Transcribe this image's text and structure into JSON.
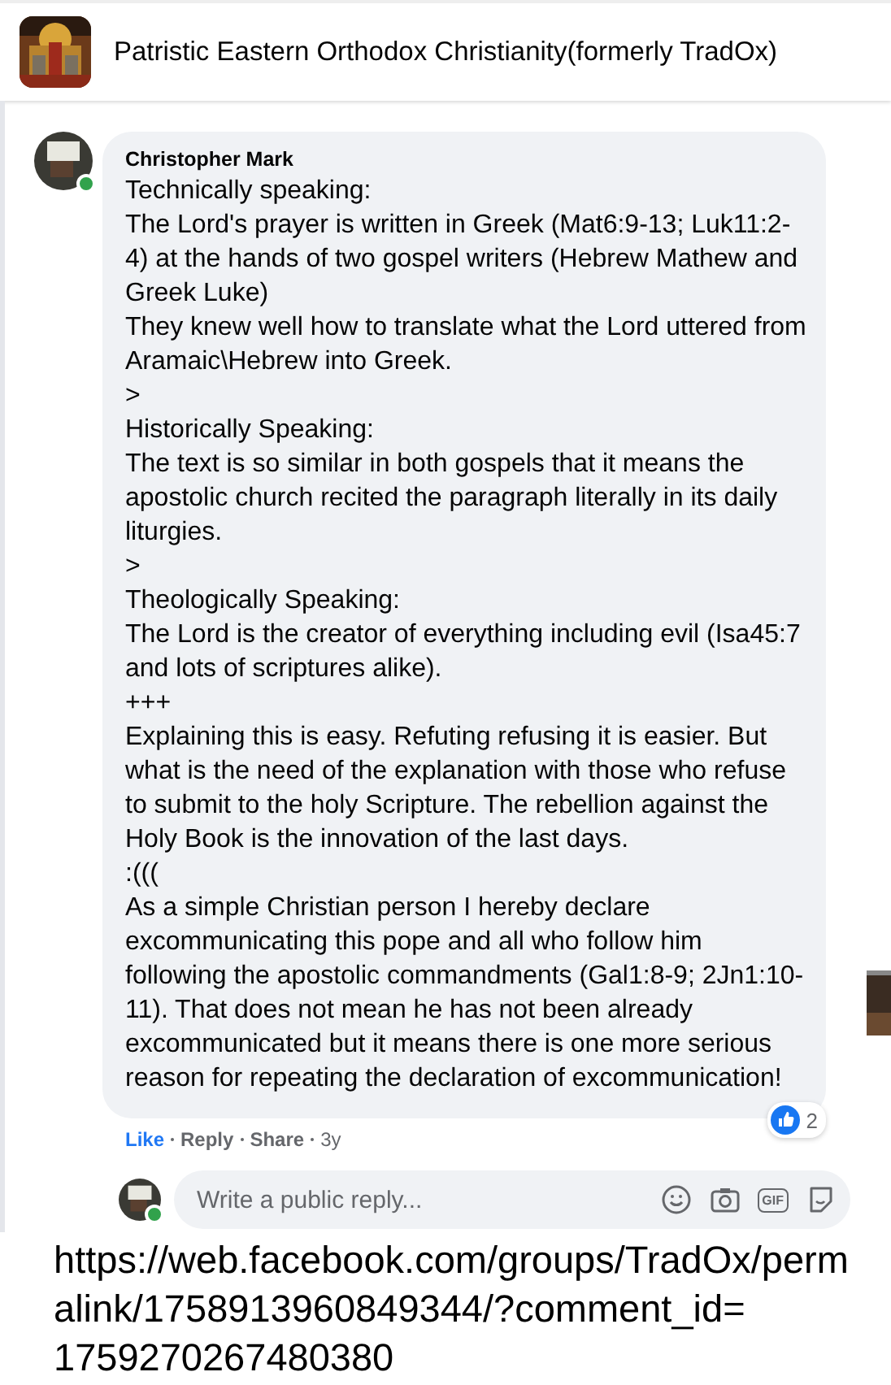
{
  "header": {
    "group_name": "Patristic Eastern Orthodox Christianity(formerly TradOx)"
  },
  "comment": {
    "author": "Christopher Mark",
    "online": true,
    "paragraphs": [
      "Technically speaking:",
      "The Lord's prayer is written in Greek (Mat6:9-13; Luk11:2-4) at the hands of two gospel writers (Hebrew Mathew and Greek Luke)",
      "They knew well how to translate what the Lord uttered from Aramaic\\Hebrew into Greek.",
      ">",
      "Historically Speaking:",
      "The text is so similar in both gospels that it means the apostolic church recited the paragraph literally in its daily liturgies.",
      ">",
      "Theologically Speaking:",
      "The Lord is the creator of everything including evil (Isa45:7 and lots of scriptures alike).",
      "+++",
      "Explaining this is easy. Refuting refusing it is easier. But what is the need of the explanation with those who refuse to submit to the holy Scripture. The rebellion against the Holy Book is the innovation of the last days.",
      ":(((",
      "As a simple Christian person I hereby declare excommunicating this pope and all who follow him following the apostolic commandments (Gal1:8-9; 2Jn1:10-11). That does not mean he has not been already excommunicated but it means there is one more serious reason for repeating the declaration of excommunication!"
    ],
    "reaction_count": "2",
    "actions": [
      {
        "label": "Like",
        "selected": true
      },
      {
        "label": "Reply",
        "selected": false
      },
      {
        "label": "Share",
        "selected": false
      }
    ],
    "age": "3y"
  },
  "composer": {
    "online": true,
    "placeholder": "Write a public reply...",
    "gif_label": "GIF"
  },
  "url_lines": [
    "https://web.facebook.com/groups/TradOx/perm",
    "alink/1758913960849344/?comment_id=",
    "1759270267480380"
  ]
}
